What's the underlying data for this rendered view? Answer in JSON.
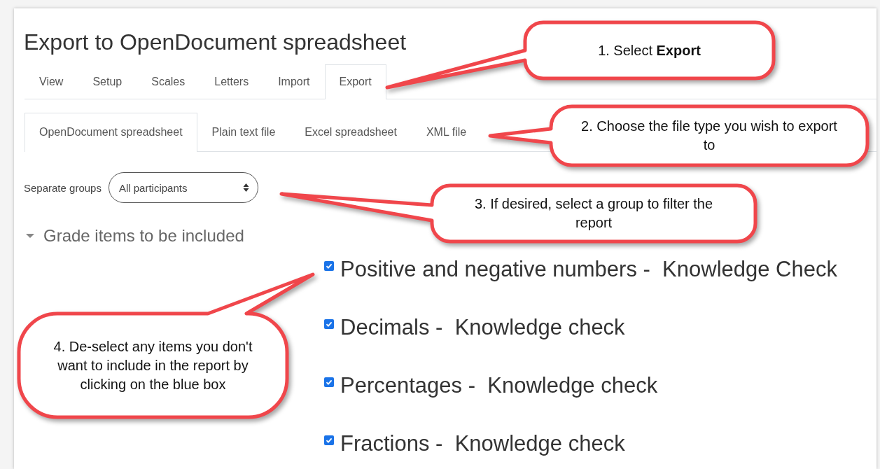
{
  "page_title": "Export to OpenDocument spreadsheet",
  "tabs": [
    {
      "label": "View",
      "selected": false
    },
    {
      "label": "Setup",
      "selected": false
    },
    {
      "label": "Scales",
      "selected": false
    },
    {
      "label": "Letters",
      "selected": false
    },
    {
      "label": "Import",
      "selected": false
    },
    {
      "label": "Export",
      "selected": true
    }
  ],
  "subtabs": [
    {
      "label": "OpenDocument spreadsheet",
      "selected": true
    },
    {
      "label": "Plain text file",
      "selected": false
    },
    {
      "label": "Excel spreadsheet",
      "selected": false
    },
    {
      "label": "XML file",
      "selected": false
    }
  ],
  "group_filter": {
    "label": "Separate groups",
    "value": "All participants"
  },
  "section": {
    "title": "Grade items to be included",
    "expanded": true
  },
  "grade_items": [
    {
      "label": "Positive and negative numbers -  Knowledge Check",
      "checked": true
    },
    {
      "label": "Decimals -  Knowledge check",
      "checked": true
    },
    {
      "label": "Percentages -  Knowledge check",
      "checked": true
    },
    {
      "label": "Fractions -  Knowledge check",
      "checked": true
    }
  ],
  "callouts": [
    {
      "text": "1. Select **Export**"
    },
    {
      "text": "2. Choose the file type you wish to export to"
    },
    {
      "text": "3. If desired, select a group to filter the report"
    },
    {
      "text": "4. De-select any items you don't want to include in the report by clicking on the blue box"
    }
  ]
}
